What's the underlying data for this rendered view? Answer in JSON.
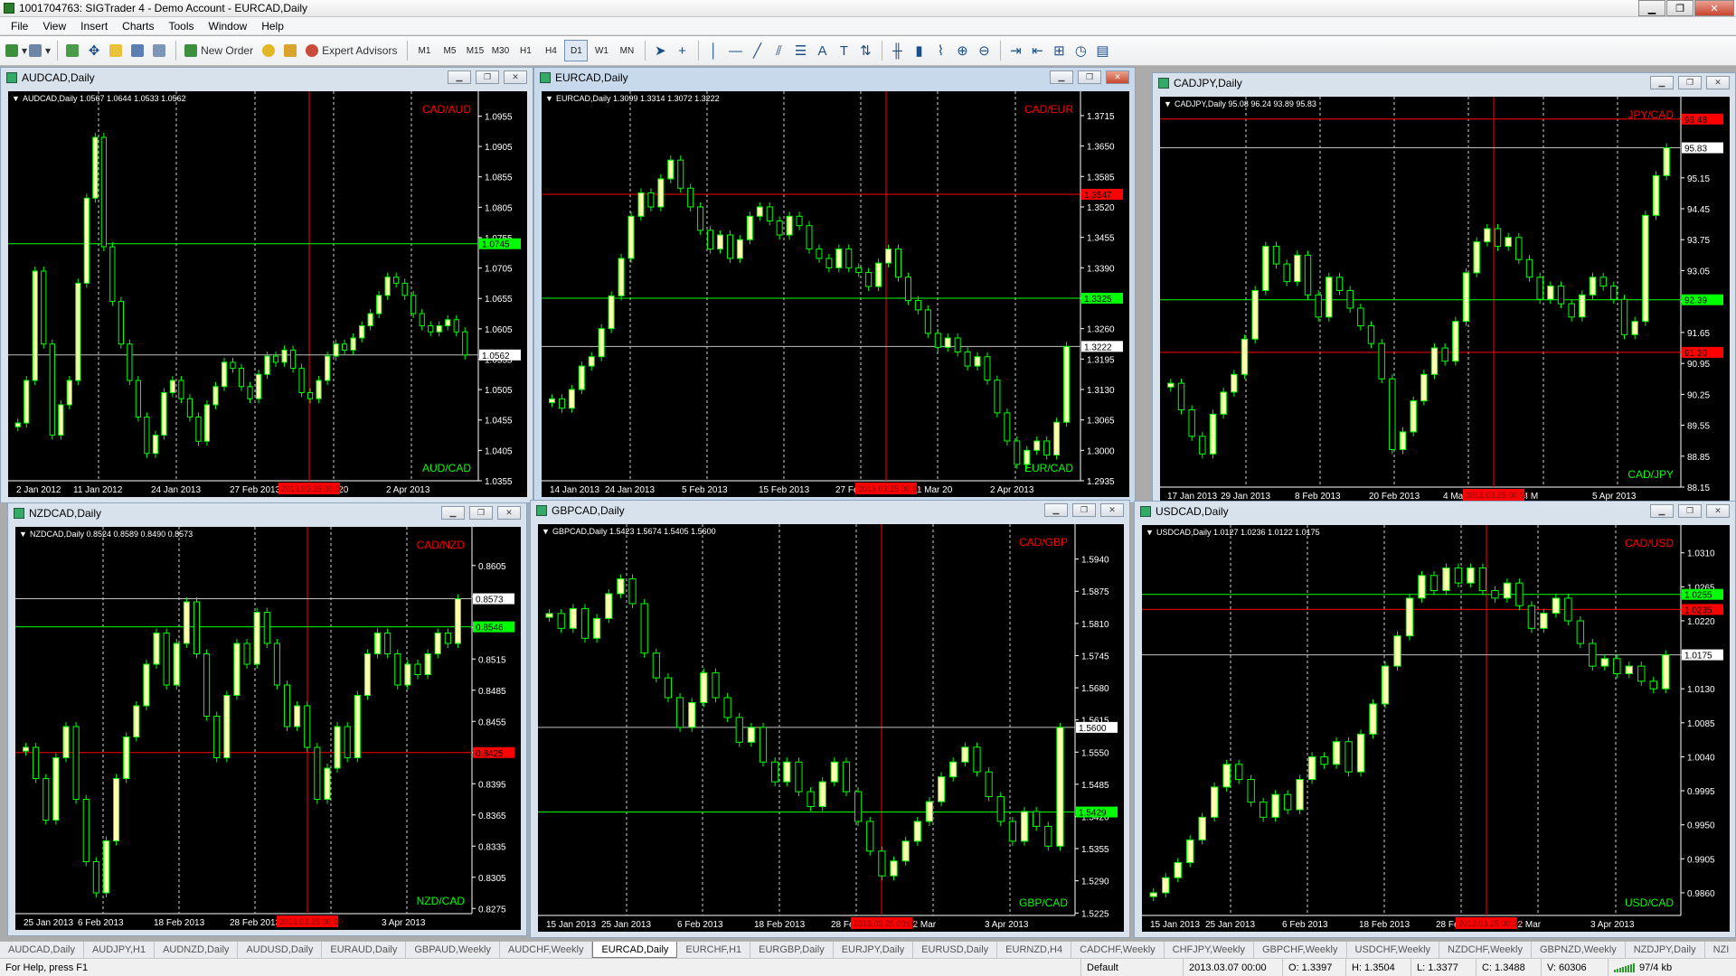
{
  "app": {
    "title": "1001704763: SIGTrader 4 - Demo Account - EURCAD,Daily",
    "window_controls": [
      "▁",
      "❐",
      "✕"
    ]
  },
  "menu": [
    "File",
    "View",
    "Insert",
    "Charts",
    "Tools",
    "Window",
    "Help"
  ],
  "toolbar": {
    "new_order": "New Order",
    "expert_advisors": "Expert Advisors",
    "timeframes": [
      "M1",
      "M5",
      "M15",
      "M30",
      "H1",
      "H4",
      "D1",
      "W1",
      "MN"
    ],
    "active_timeframe": "D1"
  },
  "colors": {
    "bull": "#ffffb0",
    "wick": "#00ff00",
    "bear": "#000000",
    "hline_green": "#00ff00",
    "hline_red": "#ff0000",
    "hline_grey": "#c0c0c0",
    "label_red": "#ff0000",
    "label_green": "#00ff00",
    "chart_bg": "#000000",
    "text": "#ffffff"
  },
  "charts": [
    {
      "window_title": "AUDCAD,Daily",
      "info": "AUDCAD,Daily  1.0567 1.0644 1.0533 1.0562",
      "label_top": "CAD/AUD",
      "label_bottom": "AUD/CAD",
      "ticks": [
        "1.0955",
        "1.0905",
        "1.0855",
        "1.0805",
        "1.0755",
        "1.0705",
        "1.0655",
        "1.0605",
        "1.0555",
        "1.0505",
        "1.0455",
        "1.0405",
        "1.0355"
      ],
      "yrange": [
        1.0355,
        1.0975
      ],
      "dates": [
        "2 Jan 2012",
        "11 Jan 2012",
        "24 Jan 2013",
        "27 Feb 2013",
        "11 Mar 20",
        "2 Apr 2013"
      ],
      "crosshair_date": "2013.03.25 00:00",
      "hlines": [
        {
          "price": 1.0745,
          "label": "1.0745",
          "color": "green"
        },
        {
          "price": 1.0562,
          "label": "1.0562",
          "color": "grey"
        }
      ],
      "closes": [
        1.045,
        1.052,
        1.07,
        1.058,
        1.043,
        1.048,
        1.052,
        1.068,
        1.082,
        1.092,
        1.074,
        1.065,
        1.058,
        1.052,
        1.046,
        1.04,
        1.043,
        1.05,
        1.052,
        1.049,
        1.046,
        1.042,
        1.048,
        1.051,
        1.055,
        1.054,
        1.051,
        1.049,
        1.053,
        1.056,
        1.055,
        1.057,
        1.054,
        1.05,
        1.049,
        1.052,
        1.056,
        1.058,
        1.057,
        1.059,
        1.061,
        1.063,
        1.066,
        1.069,
        1.068,
        1.066,
        1.063,
        1.061,
        1.06,
        1.061,
        1.062,
        1.06,
        1.0562
      ]
    },
    {
      "window_title": "EURCAD,Daily",
      "info": "EURCAD,Daily  1.3099 1.3314 1.3072 1.3222",
      "label_top": "CAD/EUR",
      "label_bottom": "EUR/CAD",
      "ticks": [
        "1.3715",
        "1.3650",
        "1.3585",
        "1.3520",
        "1.3455",
        "1.3390",
        "1.3325",
        "1.3260",
        "1.3195",
        "1.3130",
        "1.3065",
        "1.3000",
        "1.2935"
      ],
      "yrange": [
        1.2935,
        1.374
      ],
      "dates": [
        "14 Jan 2013",
        "24 Jan 2013",
        "5 Feb 2013",
        "15 Feb 2013",
        "27 Feb 2013",
        "11 Mar 20",
        "2 Apr 2013"
      ],
      "crosshair_date": "2013.03.25 00:00",
      "hlines": [
        {
          "price": 1.3547,
          "label": "1.3547",
          "color": "red"
        },
        {
          "price": 1.3325,
          "label": "1.3325",
          "color": "green"
        },
        {
          "price": 1.3222,
          "label": "1.3222",
          "color": "grey"
        }
      ],
      "closes": [
        1.311,
        1.309,
        1.313,
        1.318,
        1.32,
        1.326,
        1.333,
        1.341,
        1.35,
        1.355,
        1.352,
        1.358,
        1.362,
        1.356,
        1.352,
        1.347,
        1.343,
        1.346,
        1.341,
        1.345,
        1.35,
        1.352,
        1.349,
        1.346,
        1.35,
        1.348,
        1.343,
        1.341,
        1.339,
        1.343,
        1.339,
        1.338,
        1.335,
        1.34,
        1.343,
        1.337,
        1.332,
        1.33,
        1.325,
        1.322,
        1.324,
        1.321,
        1.318,
        1.32,
        1.315,
        1.308,
        1.302,
        1.297,
        1.3,
        1.302,
        1.299,
        1.306,
        1.3222
      ]
    },
    {
      "window_title": "CADJPY,Daily",
      "info": "CADJPY,Daily  95.08 96.24 93.89 95.83",
      "label_top": "JPY/CAD",
      "label_bottom": "CAD/JPY",
      "ticks": [
        "95.15",
        "94.45",
        "93.75",
        "93.05",
        "92.35",
        "91.65",
        "90.95",
        "90.25",
        "89.55",
        "88.85",
        "88.15"
      ],
      "yrange": [
        88.15,
        96.7
      ],
      "dates": [
        "17 Jan 2013",
        "29 Jan 2013",
        "8 Feb 2013",
        "20 Feb 2013",
        "4 Mar 2013",
        "14 M",
        "5 Apr 2013"
      ],
      "crosshair_date": "2013.03.25 00:00",
      "hlines": [
        {
          "price": 96.48,
          "label": "96.48",
          "color": "red"
        },
        {
          "price": 95.83,
          "label": "95.83",
          "color": "grey"
        },
        {
          "price": 92.39,
          "label": "92.39",
          "color": "green"
        },
        {
          "price": 91.2,
          "label": "91.20",
          "color": "red"
        }
      ],
      "closes": [
        90.5,
        89.9,
        89.3,
        88.9,
        89.8,
        90.3,
        90.7,
        91.5,
        92.6,
        93.6,
        93.2,
        92.8,
        93.4,
        92.5,
        92.0,
        92.9,
        92.6,
        92.2,
        91.8,
        91.4,
        90.6,
        89.0,
        89.4,
        90.1,
        90.7,
        91.3,
        91.0,
        91.9,
        93.0,
        93.7,
        94.0,
        93.6,
        93.8,
        93.3,
        92.9,
        92.4,
        92.7,
        92.3,
        92.0,
        92.5,
        92.9,
        92.7,
        92.4,
        91.6,
        91.9,
        94.3,
        95.2,
        95.83
      ]
    },
    {
      "window_title": "NZDCAD,Daily",
      "info": "NZDCAD,Daily  0.8524 0.8589 0.8490 0.8573",
      "label_top": "CAD/NZD",
      "label_bottom": "NZD/CAD",
      "ticks": [
        "0.8605",
        "0.8575",
        "0.8545",
        "0.8515",
        "0.8485",
        "0.8455",
        "0.8425",
        "0.8395",
        "0.8365",
        "0.8335",
        "0.8305",
        "0.8275"
      ],
      "yrange": [
        0.827,
        0.863
      ],
      "dates": [
        "25 Jan 2013",
        "6 Feb 2013",
        "18 Feb 2013",
        "28 Feb 2013",
        "12 Mar",
        "3 Apr 2013"
      ],
      "crosshair_date": "2013.03.25 00:00",
      "hlines": [
        {
          "price": 0.8573,
          "label": "0.8573",
          "color": "grey"
        },
        {
          "price": 0.8546,
          "label": "0.8546",
          "color": "green"
        },
        {
          "price": 0.8425,
          "label": "0.8425",
          "color": "red"
        }
      ],
      "closes": [
        0.843,
        0.84,
        0.836,
        0.842,
        0.845,
        0.838,
        0.832,
        0.829,
        0.834,
        0.84,
        0.844,
        0.847,
        0.851,
        0.854,
        0.849,
        0.853,
        0.857,
        0.852,
        0.846,
        0.842,
        0.848,
        0.853,
        0.851,
        0.856,
        0.853,
        0.849,
        0.845,
        0.847,
        0.843,
        0.838,
        0.841,
        0.845,
        0.842,
        0.848,
        0.852,
        0.854,
        0.852,
        0.849,
        0.851,
        0.85,
        0.852,
        0.854,
        0.853,
        0.8573
      ]
    },
    {
      "window_title": "GBPCAD,Daily",
      "info": "GBPCAD,Daily  1.5423 1.5674 1.5405 1.5600",
      "label_top": "CAD/GBP",
      "label_bottom": "GBP/CAD",
      "ticks": [
        "1.5940",
        "1.5875",
        "1.5810",
        "1.5745",
        "1.5680",
        "1.5615",
        "1.5550",
        "1.5485",
        "1.5420",
        "1.5355",
        "1.5290",
        "1.5225"
      ],
      "yrange": [
        1.522,
        1.5985
      ],
      "dates": [
        "15 Jan 2013",
        "25 Jan 2013",
        "6 Feb 2013",
        "18 Feb 2013",
        "28 Feb 2013",
        "12 Mar",
        "3 Apr 2013"
      ],
      "crosshair_date": "2013.03.25 00:00",
      "hlines": [
        {
          "price": 1.56,
          "label": "1.5600",
          "color": "grey"
        },
        {
          "price": 1.5429,
          "label": "1.5429",
          "color": "green"
        }
      ],
      "closes": [
        1.583,
        1.58,
        1.584,
        1.578,
        1.582,
        1.587,
        1.59,
        1.585,
        1.575,
        1.57,
        1.566,
        1.56,
        1.565,
        1.571,
        1.566,
        1.562,
        1.557,
        1.56,
        1.553,
        1.549,
        1.553,
        1.547,
        1.544,
        1.549,
        1.553,
        1.547,
        1.541,
        1.535,
        1.53,
        1.533,
        1.537,
        1.541,
        1.545,
        1.55,
        1.553,
        1.556,
        1.551,
        1.546,
        1.541,
        1.537,
        1.543,
        1.54,
        1.536,
        1.56
      ]
    },
    {
      "window_title": "USDCAD,Daily",
      "info": "USDCAD,Daily  1.0127 1.0236 1.0122 1.0175",
      "label_top": "CAD/USD",
      "label_bottom": "USD/CAD",
      "ticks": [
        "1.0310",
        "1.0265",
        "1.0220",
        "1.0175",
        "1.0130",
        "1.0085",
        "1.0040",
        "0.9995",
        "0.9950",
        "0.9905",
        "0.9860"
      ],
      "yrange": [
        0.983,
        1.033
      ],
      "dates": [
        "15 Jan 2013",
        "25 Jan 2013",
        "6 Feb 2013",
        "18 Feb 2013",
        "28 Feb 2013",
        "12 Mar",
        "3 Apr 2013"
      ],
      "crosshair_date": "2013.03.25 00:00",
      "hlines": [
        {
          "price": 1.0255,
          "label": "1.0255",
          "color": "green"
        },
        {
          "price": 1.0235,
          "label": "1.0235",
          "color": "red"
        },
        {
          "price": 1.0175,
          "label": "1.0175",
          "color": "grey"
        }
      ],
      "closes": [
        0.986,
        0.988,
        0.99,
        0.993,
        0.996,
        1.0,
        1.003,
        1.001,
        0.998,
        0.996,
        0.999,
        0.997,
        1.001,
        1.004,
        1.003,
        1.006,
        1.002,
        1.007,
        1.011,
        1.016,
        1.02,
        1.025,
        1.028,
        1.026,
        1.029,
        1.027,
        1.029,
        1.026,
        1.025,
        1.027,
        1.024,
        1.021,
        1.023,
        1.025,
        1.022,
        1.019,
        1.016,
        1.017,
        1.015,
        1.016,
        1.014,
        1.013,
        1.0175
      ]
    }
  ],
  "tabs": [
    "AUDCAD,Daily",
    "AUDJPY,H1",
    "AUDNZD,Daily",
    "AUDUSD,Daily",
    "EURAUD,Daily",
    "GBPAUD,Weekly",
    "AUDCHF,Weekly",
    "EURCAD,Daily",
    "EURCHF,H1",
    "EURGBP,Daily",
    "EURJPY,Daily",
    "EURUSD,Daily",
    "EURNZD,H4",
    "CADCHF,Weekly",
    "CHFJPY,Weekly",
    "GBPCHF,Weekly",
    "USDCHF,Weekly",
    "NZDCHF,Weekly",
    "GBPNZD,Weekly",
    "NZDJPY,Daily",
    "NZI"
  ],
  "active_tab": "EURCAD,Daily",
  "status": {
    "help": "For Help, press F1",
    "profile": "Default",
    "datetime": "2013.03.07 00:00",
    "open": "O: 1.3397",
    "high": "H: 1.3504",
    "low": "L: 1.3377",
    "close": "C: 1.3488",
    "volume": "V: 60306",
    "traffic": "97/4 kb"
  }
}
